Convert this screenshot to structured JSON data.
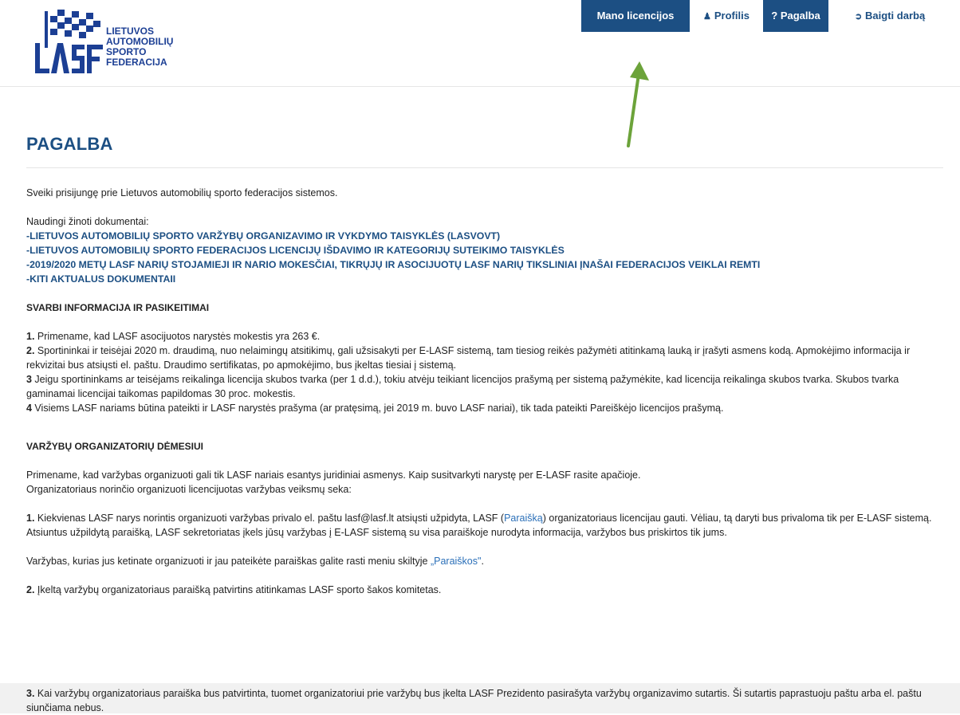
{
  "logo": {
    "lines": [
      "LIETUVOS",
      "AUTOMOBILIŲ",
      "SPORTO",
      "FEDERACIJA"
    ],
    "mark_text": "LASF",
    "brand_color": "#1c3f94"
  },
  "nav": {
    "licences": "Mano licencijos",
    "profile": "Profilis",
    "help": "? Pagalba",
    "logout": "Baigti darbą",
    "profile_icon": "user-icon",
    "logout_icon": "sign-out-icon",
    "primary_color": "#1c4f83"
  },
  "annotation": {
    "arrow_color": "#6ca33a"
  },
  "page": {
    "title": "PAGALBA",
    "welcome": "Sveiki prisijungę prie Lietuvos automobilių sporto federacijos sistemos.",
    "docs_intro": "Naudingi žinoti dokumentai:",
    "docs": [
      "-LIETUVOS AUTOMOBILIŲ SPORTO VARŽYBŲ ORGANIZAVIMO IR VYKDYMO TAISYKLĖS (LASVOVT)",
      "-LIETUVOS AUTOMOBILIŲ SPORTO FEDERACIJOS LICENCIJŲ IŠDAVIMO IR KATEGORIJŲ SUTEIKIMO TAISYKLĖS",
      "-2019/2020 METŲ LASF NARIŲ STOJAMIEJI IR NARIO MOKESČIAI, TIKRŲJŲ IR ASOCIJUOTŲ LASF NARIŲ TIKSLINIAI ĮNAŠAI FEDERACIJOS VEIKLAI REMTI",
      "-KITI AKTUALUS DOKUMENTAII"
    ],
    "important_title": "SVARBI INFORMACIJA IR PASIKEITIMAI",
    "important": [
      {
        "num": "1.",
        "text": " Primename, kad LASF asocijuotos narystės mokestis yra 263 €."
      },
      {
        "num": "2.",
        "text": " Sportininkai ir teisėjai 2020 m. draudimą, nuo nelaimingų atsitikimų, gali užsisakyti per E-LASF sistemą, tam tiesiog reikės pažymėti atitinkamą lauką ir įrašyti asmens kodą. Apmokėjimo informacija ir rekvizitai bus atsiųsti el. paštu. Draudimo sertifikatas, po apmokėjimo, bus įkeltas tiesiai į sistemą."
      },
      {
        "num": "3",
        "text": " Jeigu sportininkams ar teisėjams reikalinga licencija skubos tvarka (per 1 d.d.), tokiu atvėju teikiant licencijos prašymą per sistemą pažymėkite, kad licencija reikalinga skubos tvarka. Skubos tvarka gaminamai licencijai taikomas papildomas 30 proc. mokestis."
      },
      {
        "num": "4",
        "text": " Visiems LASF nariams būtina pateikti ir LASF narystės prašyma (ar pratęsimą, jei 2019 m. buvo LASF nariai), tik tada pateikti Pareiškėjo licencijos prašymą."
      }
    ],
    "organizers_title": "VARŽYBŲ ORGANIZATORIŲ DĖMESIUI",
    "organizers_intro_1": "Primename, kad varžybas organizuoti gali tik LASF nariais esantys juridiniai asmenys. Kaip susitvarkyti narystę per E-LASF rasite apačioje.",
    "organizers_intro_2": "Organizatoriaus norinčio organizuoti licencijuotas varžybas veiksmų seka:",
    "step1_num": "1.",
    "step1_a": " Kiekvienas LASF narys norintis organizuoti varžybas privalo el. paštu lasf@lasf.lt atsiųsti užpidyta, LASF (",
    "step1_link": "Paraišką",
    "step1_b": ") organizatoriaus licencijau gauti. Vėliau, tą daryti bus privaloma tik per E-LASF sistemą.",
    "step1_c": "Atsiuntus užpildytą paraišką, LASF sekretoriatas įkels jūsų varžybas į E-LASF sistemą su visa paraiškoje nurodyta informacija, varžybos bus priskirtos tik jums.",
    "applications_a": "Varžybas, kurias jus ketinate organizuoti ir jau pateikėte paraiškas galite rasti meniu skiltyje ",
    "applications_link": "„Paraiškos\"",
    "applications_b": ".",
    "step2_num": "2.",
    "step2": " Įkeltą varžybų organizatoriaus paraišką patvirtins atitinkamas LASF sporto šakos komitetas.",
    "step3_num": "3.",
    "step3": " Kai varžybų organizatoriaus paraiška bus patvirtinta, tuomet organizatoriui prie varžybų bus įkelta LASF Prezidento pasirašyta varžybų organizavimo sutartis. Ši sutartis paprastuoju paštu arba el. paštu siunčiama nebus."
  }
}
